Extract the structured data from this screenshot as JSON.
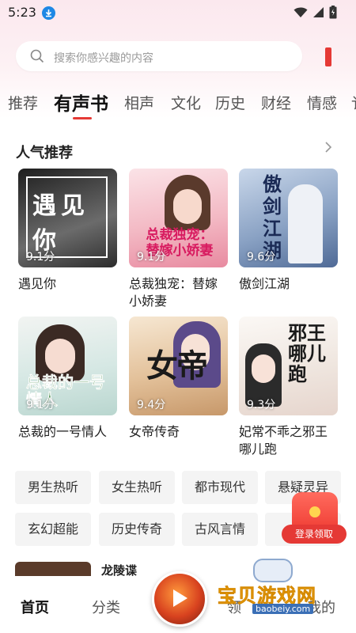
{
  "status_bar": {
    "time": "5:23"
  },
  "search": {
    "placeholder": "搜索你感兴趣的内容"
  },
  "tabs": [
    {
      "label": "推荐",
      "active": false
    },
    {
      "label": "有声书",
      "active": true
    },
    {
      "label": "相声",
      "active": false
    },
    {
      "label": "文化",
      "active": false
    },
    {
      "label": "历史",
      "active": false
    },
    {
      "label": "财经",
      "active": false
    },
    {
      "label": "情感",
      "active": false
    },
    {
      "label": "讠",
      "active": false
    }
  ],
  "section": {
    "title": "人气推荐",
    "books": [
      {
        "title": "遇见你",
        "score": "9.1分",
        "cover_text": "遇见你",
        "cover_color": "#3a3a3a"
      },
      {
        "title": "总裁独宠：替嫁小娇妻",
        "score": "9.1分",
        "cover_text": "总裁独宠：替嫁小娇妻",
        "cover_color": "#f4c7cf"
      },
      {
        "title": "傲剑江湖",
        "score": "9.6分",
        "cover_text": "傲剑江湖",
        "cover_color": "#9fb3cf"
      },
      {
        "title": "总裁的一号情人",
        "score": "9.1分",
        "cover_text": "总裁的一号情人",
        "cover_color": "#cfe5e2"
      },
      {
        "title": "女帝传奇",
        "score": "9.4分",
        "cover_text": "女帝",
        "cover_color": "#e7c9a6"
      },
      {
        "title": "妃常不乖之邪王哪儿跑",
        "score": "9.3分",
        "cover_text": "邪王哪儿跑",
        "cover_color": "#f1ece8"
      }
    ]
  },
  "tags": [
    "男生热听",
    "女生热听",
    "都市现代",
    "悬疑灵异",
    "玄幻超能",
    "历史传奇",
    "古风言情"
  ],
  "float_promo": {
    "label": "登录领取"
  },
  "list_preview": {
    "title": "龙陵谍"
  },
  "bottom_nav": {
    "items": [
      {
        "label": "首页",
        "active": true
      },
      {
        "label": "分类",
        "active": false
      },
      {
        "label": "领",
        "active": false
      },
      {
        "label": "我的",
        "active": false
      }
    ]
  },
  "watermark": {
    "text": "宝贝游戏网",
    "url": "baobeiy.com"
  },
  "colors": {
    "accent": "#e53935",
    "tag_bg": "#f4f4f4",
    "header_bg": "#fbe8ee"
  }
}
